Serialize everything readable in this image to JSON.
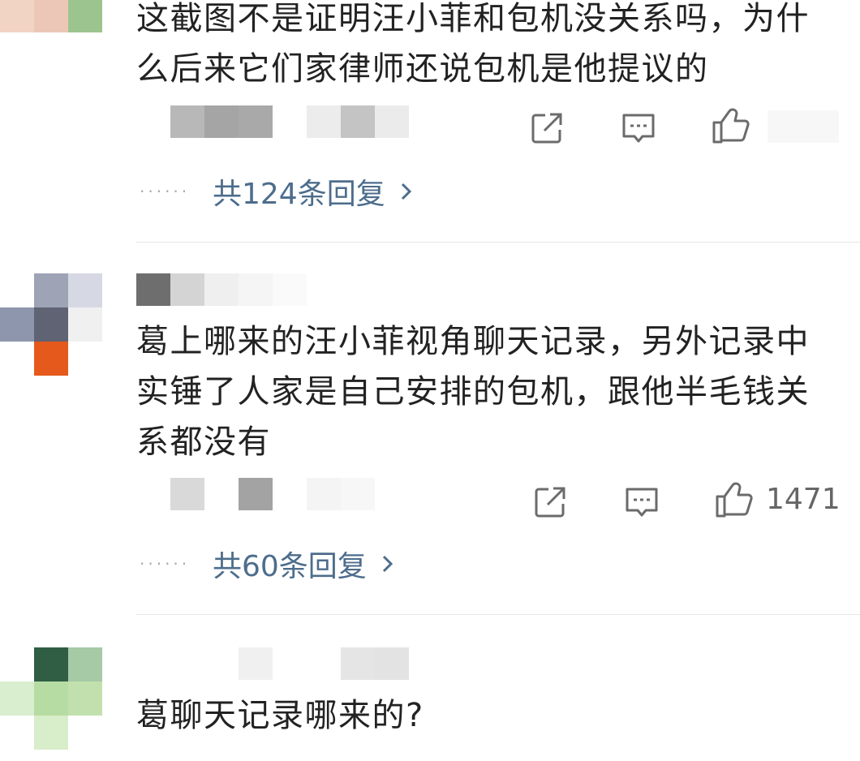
{
  "comments": [
    {
      "text": "这截图不是证明汪小菲和包机没关系吗，为什么后来它们家律师还说包机是他提议的",
      "reply_link": "共124条回复",
      "like_count": ""
    },
    {
      "text": "葛上哪来的汪小菲视角聊天记录，另外记录中实锤了人家是自己安排的包机，跟他半毛钱关系都没有",
      "reply_link": "共60条回复",
      "like_count": "1471"
    },
    {
      "text": "葛聊天记录哪来的?"
    }
  ],
  "icons": {
    "repost": "repost-icon",
    "comment": "comment-icon",
    "like": "thumbs-up-icon",
    "chevron": "chevron-right-icon"
  },
  "colors": {
    "text": "#222222",
    "reply_link": "#4d6d8c",
    "icon_gray": "#6b6b6b",
    "divider": "#e6e6e6"
  }
}
